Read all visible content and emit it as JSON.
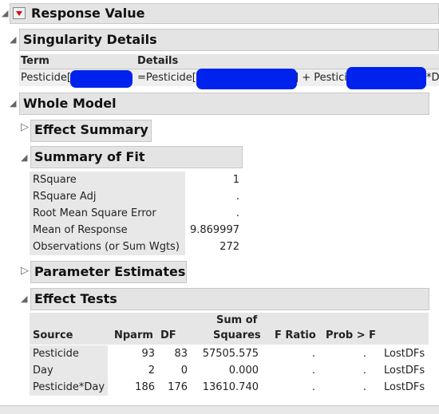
{
  "response": {
    "title": "Response Value"
  },
  "singularity": {
    "title": "Singularity Details",
    "col_term": "Term",
    "col_details": "Details",
    "term": "Pesticide[",
    "details_a": "=Pesticide[",
    "details_b": "] + Pesticide",
    "details_c": "*D"
  },
  "whole_model": {
    "title": "Whole Model"
  },
  "effect_summary": {
    "title": "Effect Summary"
  },
  "summary_of_fit": {
    "title": "Summary of Fit",
    "rows": [
      {
        "label": "RSquare",
        "value": "1"
      },
      {
        "label": "RSquare Adj",
        "value": "."
      },
      {
        "label": "Root Mean Square Error",
        "value": "."
      },
      {
        "label": "Mean of Response",
        "value": "9.869997"
      },
      {
        "label": "Observations (or Sum Wgts)",
        "value": "272"
      }
    ]
  },
  "parameter_estimates": {
    "title": "Parameter Estimates"
  },
  "effect_tests": {
    "title": "Effect Tests",
    "headers": {
      "source": "Source",
      "nparm": "Nparm",
      "df": "DF",
      "ss_top": "Sum of",
      "ss_bottom": "Squares",
      "fratio": "F Ratio",
      "prob": "Prob > F"
    },
    "rows": [
      {
        "source": "Pesticide",
        "nparm": "93",
        "df": "83",
        "ss": "57505.575",
        "fratio": ".",
        "prob": ".",
        "note": "LostDFs"
      },
      {
        "source": "Day",
        "nparm": "2",
        "df": "0",
        "ss": "0.000",
        "fratio": ".",
        "prob": ".",
        "note": "LostDFs"
      },
      {
        "source": "Pesticide*Day",
        "nparm": "186",
        "df": "176",
        "ss": "13610.740",
        "fratio": ".",
        "prob": ".",
        "note": "LostDFs"
      }
    ]
  },
  "colors": {
    "header_bg": "#e4e4e4",
    "redaction": "#0022ee",
    "menu_arrow": "#d01010"
  }
}
